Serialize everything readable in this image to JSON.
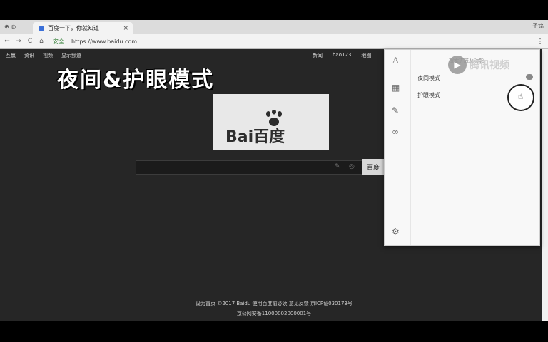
{
  "browser": {
    "tab_title": "百度一下，你就知道",
    "tab_close": "×",
    "window_controls": "子铭",
    "nav_back": "←",
    "nav_forward": "→",
    "nav_reload": "C",
    "nav_home": "⌂",
    "security": "安全",
    "url": "https://www.baidu.com",
    "menu": "⋮"
  },
  "page": {
    "top_nav_left": [
      "互赢",
      "资讯",
      "视频",
      "显示频道"
    ],
    "top_nav_right": [
      "新闻",
      "hao123",
      "地图"
    ],
    "overlay_title": "夜间&护眼模式",
    "logo_text": "Bai百度",
    "search_button": "百度",
    "footer_line1": "设为首页 ©2017 Baidu 使用百度前必读 意见反馈 京ICP证030173号",
    "footer_line2": "京公网安备11000002000001号"
  },
  "panel": {
    "search_placeholder": "搜索扩展及功能",
    "option_night": "夜间模式",
    "option_eye": "护眼模式"
  },
  "watermark": {
    "text": "腾讯视频"
  }
}
